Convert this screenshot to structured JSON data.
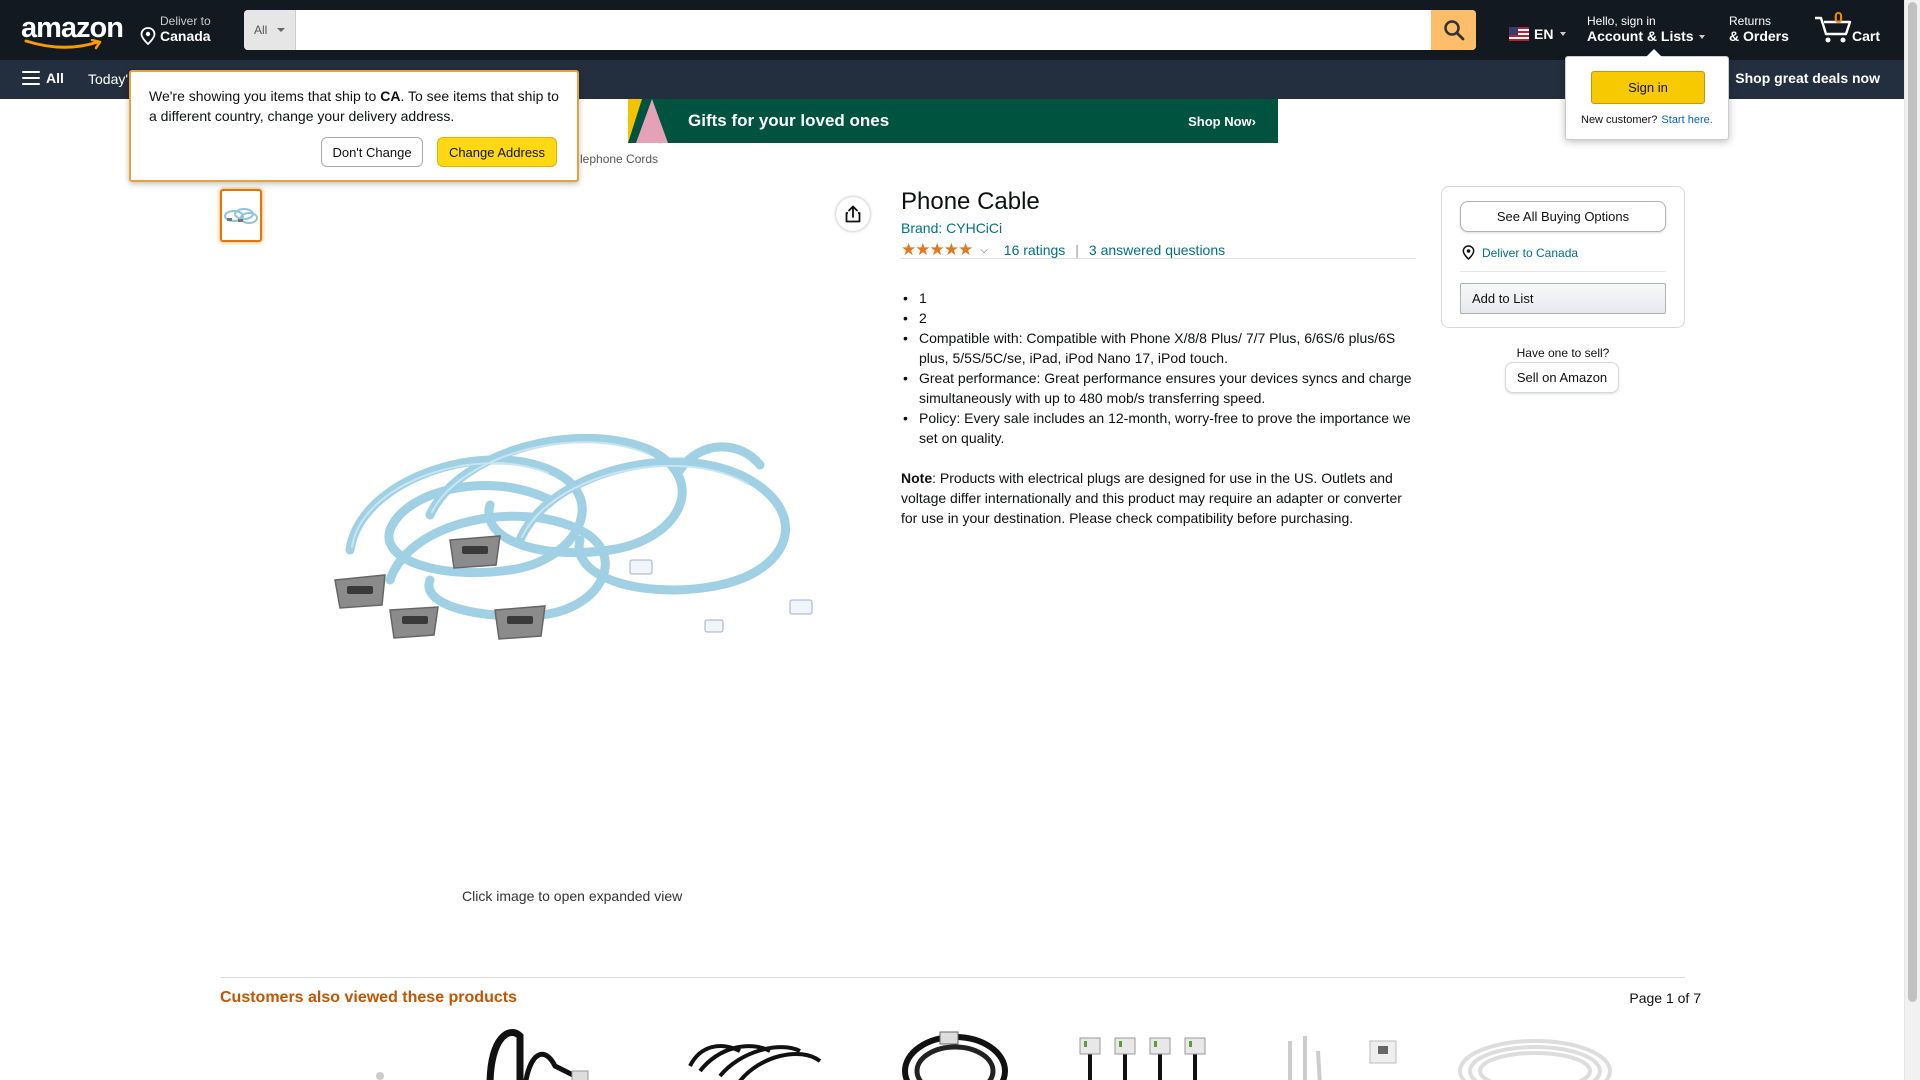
{
  "header": {
    "logo_text": "amazon",
    "deliver_line1": "Deliver to",
    "deliver_line2": "Canada",
    "search_category": "All",
    "search_placeholder": "",
    "language": "EN",
    "account_line1": "Hello, sign in",
    "account_line2": "Account & Lists",
    "returns_line1": "Returns",
    "returns_line2": "& Orders",
    "cart_count": "0",
    "cart_label": "Cart"
  },
  "subnav": {
    "all_label": "All",
    "todays_deals": "Today's Deals",
    "promo": "Shop great deals now"
  },
  "banner": {
    "title": "Gifts for your loved ones",
    "cta": "Shop Now›"
  },
  "breadcrumb": "lephone Cords",
  "delivery_popover": {
    "msg_before": "We're showing you items that ship to ",
    "country": "CA",
    "msg_after": ". To see items that ship to a different country, change your delivery address.",
    "dont_change": "Don't Change",
    "change_address": "Change Address"
  },
  "signin_flyout": {
    "button": "Sign in",
    "new_customer": "New customer?",
    "start_here": "Start here."
  },
  "image": {
    "caption": "Click image to open expanded view"
  },
  "product": {
    "title": "Phone Cable",
    "brand": "Brand: CYHCiCi",
    "stars": "★★★★★",
    "rating_value": 5,
    "ratings": "16 ratings",
    "questions": "3 answered questions",
    "bullets": [
      "1",
      "2",
      "Compatible with: Compatible with Phone X/8/8 Plus/ 7/7 Plus, 6/6S/6 plus/6S plus, 5/5S/5C/se, iPad, iPod Nano 17, iPod touch.",
      "Great performance: Great performance ensures your devices syncs and charge simultaneously with up to 480 mob/s transferring speed.",
      "Policy: Every sale includes an 12-month, worry-free to prove the importance we set on quality."
    ],
    "note_label": "Note",
    "note_text": ": Products with electrical plugs are designed for use in the US. Outlets and voltage differ internationally and this product may require an adapter or converter for use in your destination. Please check compatibility before purchasing."
  },
  "buybox": {
    "see_all": "See All Buying Options",
    "deliver": "Deliver to Canada",
    "add_to_list": "Add to List",
    "have_one": "Have one to sell?",
    "sell_on_amazon": "Sell on Amazon"
  },
  "carousel": {
    "title": "Customers also viewed these products",
    "page": "Page 1 of 7"
  },
  "colors": {
    "nav_dark": "#131921",
    "nav_sub": "#232f3e",
    "search_button": "#febd69",
    "cart_count": "#f08804",
    "link": "#007185",
    "star": "#de7921",
    "carousel_title": "#c45500",
    "primary_button": "#ffd814"
  }
}
